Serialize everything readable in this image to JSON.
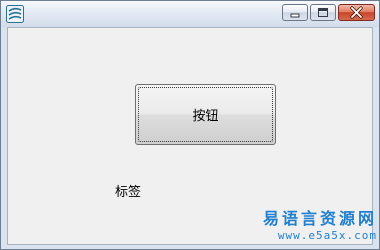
{
  "window": {
    "title": "",
    "app_icon": "app-icon",
    "controls": {
      "minimize_icon": "minimize-icon",
      "maximize_icon": "maximize-icon",
      "close_icon": "close-icon"
    }
  },
  "form": {
    "button_label": "按钮",
    "label_text": "标签"
  },
  "watermark": {
    "title": "易语言资源网",
    "url": "www.e5a5x.com"
  },
  "colors": {
    "client_background": "#f0f0f0",
    "close_button": "#c8452a",
    "watermark": "#1f7fd0"
  }
}
